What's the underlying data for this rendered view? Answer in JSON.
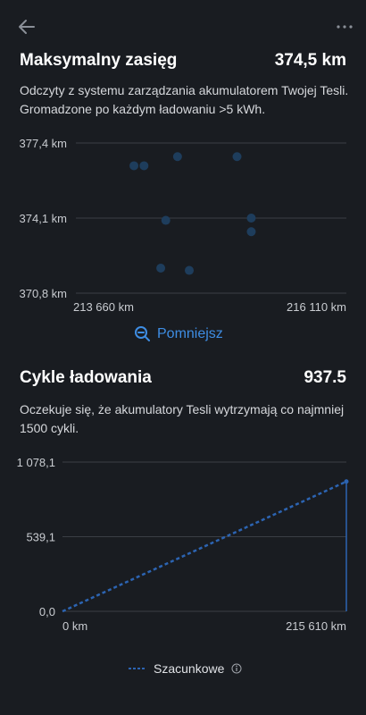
{
  "icons": {
    "back": "arrow-left-icon",
    "more": "ellipsis-icon",
    "less": "zoom-out-icon",
    "info": "info-icon"
  },
  "colors": {
    "background": "#191c21",
    "dot": "#1e3d5c",
    "accent": "#3e8de3",
    "line": "#2c64b2",
    "grid": "#3a3e45"
  },
  "range": {
    "title": "Maksymalny zasięg",
    "value": "374,5 km",
    "description": "Odczyty z systemu zarządzania akumulatorem Twojej Tesli. Gromadzone po każdym ładowaniu >5 kWh.",
    "less_label": "Pomniejsz"
  },
  "cycles": {
    "title": "Cykle ładowania",
    "value": "937.5",
    "description": "Oczekuje się, że akumulatory Tesli wytrzymają co najmniej 1500 cykli.",
    "legend_label": "Szacunkowe"
  },
  "chart_data": [
    {
      "type": "scatter",
      "y_ticks": [
        "377,4 km",
        "374,1 km",
        "370,8 km"
      ],
      "x_ticks": [
        "213 660 km",
        "216 110 km"
      ],
      "xlim": [
        213660,
        216110
      ],
      "ylim": [
        370.8,
        377.4
      ],
      "grid": true,
      "points": [
        {
          "x": 213980,
          "y": 376.4
        },
        {
          "x": 214100,
          "y": 376.4
        },
        {
          "x": 214500,
          "y": 376.8
        },
        {
          "x": 214360,
          "y": 374.0
        },
        {
          "x": 214300,
          "y": 371.9
        },
        {
          "x": 214640,
          "y": 371.8
        },
        {
          "x": 215210,
          "y": 376.8
        },
        {
          "x": 215380,
          "y": 374.1
        },
        {
          "x": 215380,
          "y": 373.5
        }
      ]
    },
    {
      "type": "line",
      "y_ticks": [
        "1 078,1",
        "539,1",
        "0,0"
      ],
      "x_ticks": [
        "0 km",
        "215 610 km"
      ],
      "xlim": [
        0,
        215610
      ],
      "ylim": [
        0,
        1078.1
      ],
      "grid": true,
      "legend": "bottom",
      "series": [
        {
          "name": "Szacunkowe",
          "style": "dashed",
          "x": [
            0,
            215610
          ],
          "y": [
            0,
            937.5
          ]
        }
      ]
    }
  ]
}
